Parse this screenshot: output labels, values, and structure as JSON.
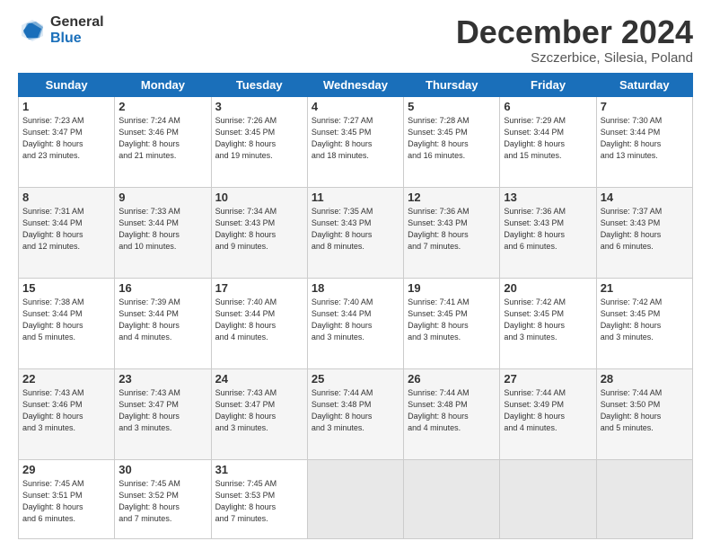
{
  "logo": {
    "general": "General",
    "blue": "Blue"
  },
  "title": "December 2024",
  "subtitle": "Szczerbice, Silesia, Poland",
  "days_of_week": [
    "Sunday",
    "Monday",
    "Tuesday",
    "Wednesday",
    "Thursday",
    "Friday",
    "Saturday"
  ],
  "weeks": [
    [
      {
        "day": "1",
        "info": "Sunrise: 7:23 AM\nSunset: 3:47 PM\nDaylight: 8 hours\nand 23 minutes."
      },
      {
        "day": "2",
        "info": "Sunrise: 7:24 AM\nSunset: 3:46 PM\nDaylight: 8 hours\nand 21 minutes."
      },
      {
        "day": "3",
        "info": "Sunrise: 7:26 AM\nSunset: 3:45 PM\nDaylight: 8 hours\nand 19 minutes."
      },
      {
        "day": "4",
        "info": "Sunrise: 7:27 AM\nSunset: 3:45 PM\nDaylight: 8 hours\nand 18 minutes."
      },
      {
        "day": "5",
        "info": "Sunrise: 7:28 AM\nSunset: 3:45 PM\nDaylight: 8 hours\nand 16 minutes."
      },
      {
        "day": "6",
        "info": "Sunrise: 7:29 AM\nSunset: 3:44 PM\nDaylight: 8 hours\nand 15 minutes."
      },
      {
        "day": "7",
        "info": "Sunrise: 7:30 AM\nSunset: 3:44 PM\nDaylight: 8 hours\nand 13 minutes."
      }
    ],
    [
      {
        "day": "8",
        "info": "Sunrise: 7:31 AM\nSunset: 3:44 PM\nDaylight: 8 hours\nand 12 minutes."
      },
      {
        "day": "9",
        "info": "Sunrise: 7:33 AM\nSunset: 3:44 PM\nDaylight: 8 hours\nand 10 minutes."
      },
      {
        "day": "10",
        "info": "Sunrise: 7:34 AM\nSunset: 3:43 PM\nDaylight: 8 hours\nand 9 minutes."
      },
      {
        "day": "11",
        "info": "Sunrise: 7:35 AM\nSunset: 3:43 PM\nDaylight: 8 hours\nand 8 minutes."
      },
      {
        "day": "12",
        "info": "Sunrise: 7:36 AM\nSunset: 3:43 PM\nDaylight: 8 hours\nand 7 minutes."
      },
      {
        "day": "13",
        "info": "Sunrise: 7:36 AM\nSunset: 3:43 PM\nDaylight: 8 hours\nand 6 minutes."
      },
      {
        "day": "14",
        "info": "Sunrise: 7:37 AM\nSunset: 3:43 PM\nDaylight: 8 hours\nand 6 minutes."
      }
    ],
    [
      {
        "day": "15",
        "info": "Sunrise: 7:38 AM\nSunset: 3:44 PM\nDaylight: 8 hours\nand 5 minutes."
      },
      {
        "day": "16",
        "info": "Sunrise: 7:39 AM\nSunset: 3:44 PM\nDaylight: 8 hours\nand 4 minutes."
      },
      {
        "day": "17",
        "info": "Sunrise: 7:40 AM\nSunset: 3:44 PM\nDaylight: 8 hours\nand 4 minutes."
      },
      {
        "day": "18",
        "info": "Sunrise: 7:40 AM\nSunset: 3:44 PM\nDaylight: 8 hours\nand 3 minutes."
      },
      {
        "day": "19",
        "info": "Sunrise: 7:41 AM\nSunset: 3:45 PM\nDaylight: 8 hours\nand 3 minutes."
      },
      {
        "day": "20",
        "info": "Sunrise: 7:42 AM\nSunset: 3:45 PM\nDaylight: 8 hours\nand 3 minutes."
      },
      {
        "day": "21",
        "info": "Sunrise: 7:42 AM\nSunset: 3:45 PM\nDaylight: 8 hours\nand 3 minutes."
      }
    ],
    [
      {
        "day": "22",
        "info": "Sunrise: 7:43 AM\nSunset: 3:46 PM\nDaylight: 8 hours\nand 3 minutes."
      },
      {
        "day": "23",
        "info": "Sunrise: 7:43 AM\nSunset: 3:47 PM\nDaylight: 8 hours\nand 3 minutes."
      },
      {
        "day": "24",
        "info": "Sunrise: 7:43 AM\nSunset: 3:47 PM\nDaylight: 8 hours\nand 3 minutes."
      },
      {
        "day": "25",
        "info": "Sunrise: 7:44 AM\nSunset: 3:48 PM\nDaylight: 8 hours\nand 3 minutes."
      },
      {
        "day": "26",
        "info": "Sunrise: 7:44 AM\nSunset: 3:48 PM\nDaylight: 8 hours\nand 4 minutes."
      },
      {
        "day": "27",
        "info": "Sunrise: 7:44 AM\nSunset: 3:49 PM\nDaylight: 8 hours\nand 4 minutes."
      },
      {
        "day": "28",
        "info": "Sunrise: 7:44 AM\nSunset: 3:50 PM\nDaylight: 8 hours\nand 5 minutes."
      }
    ],
    [
      {
        "day": "29",
        "info": "Sunrise: 7:45 AM\nSunset: 3:51 PM\nDaylight: 8 hours\nand 6 minutes."
      },
      {
        "day": "30",
        "info": "Sunrise: 7:45 AM\nSunset: 3:52 PM\nDaylight: 8 hours\nand 7 minutes."
      },
      {
        "day": "31",
        "info": "Sunrise: 7:45 AM\nSunset: 3:53 PM\nDaylight: 8 hours\nand 7 minutes."
      },
      {
        "day": "",
        "info": ""
      },
      {
        "day": "",
        "info": ""
      },
      {
        "day": "",
        "info": ""
      },
      {
        "day": "",
        "info": ""
      }
    ]
  ]
}
